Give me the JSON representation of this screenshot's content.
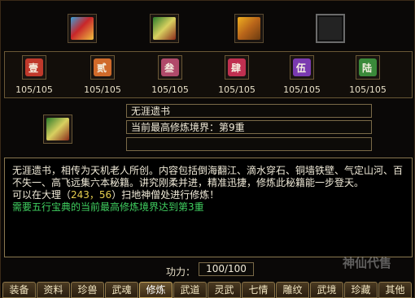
{
  "top_slots": [
    {
      "icon": "book-red-icon"
    },
    {
      "icon": "book-green-icon"
    },
    {
      "icon": "book-gold-icon"
    },
    {
      "icon": "empty-slot"
    }
  ],
  "scrolls": [
    {
      "glyph": "壹",
      "count": "105/105",
      "color": "#c0392b"
    },
    {
      "glyph": "贰",
      "count": "105/105",
      "color": "#d06a2a"
    },
    {
      "glyph": "叁",
      "count": "105/105",
      "color": "#b04a6a"
    },
    {
      "glyph": "肆",
      "count": "105/105",
      "color": "#c03050"
    },
    {
      "glyph": "伍",
      "count": "105/105",
      "color": "#7a3ab0"
    },
    {
      "glyph": "陆",
      "count": "105/105",
      "color": "#3a8a3a"
    }
  ],
  "book": {
    "name": "无涯遗书",
    "level_line": "当前最高修炼境界：第9重",
    "extra": ""
  },
  "description": {
    "text": "无涯遗书，相传为天机老人所创。内容包括倒海翻江、滴水穿石、铜墙铁壁、气定山河、百不失一、高飞远集六本秘籍。讲究刚柔并进，精准迅捷，修炼此秘籍能一步登天。",
    "loc_prefix": "可以在大理（",
    "loc_coord": "243，56",
    "loc_suffix": "）扫地神僧处进行修炼！",
    "requirement": "需要五行宝典的当前最高修炼境界达到第3重"
  },
  "power": {
    "label": "功力：",
    "value": "100/100"
  },
  "tabs": [
    "装备",
    "资料",
    "珍兽",
    "武魂",
    "修炼",
    "武道",
    "灵武",
    "七情",
    "雕纹",
    "武境",
    "珍藏",
    "其他"
  ],
  "active_tab": "修炼",
  "watermark": "神仙代售"
}
